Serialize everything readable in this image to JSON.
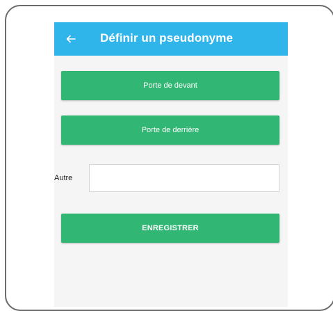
{
  "app_bar": {
    "title": "Définir un pseudonyme",
    "back_icon": "arrow-left-icon",
    "color": "#2fb5ea"
  },
  "buttons": {
    "front_door_label": "Porte de devant",
    "back_door_label": "Porte de derrière",
    "save_label": "ENREGISTRER",
    "color": "#31b673"
  },
  "other_field": {
    "label": "Autre",
    "value": "",
    "placeholder": ""
  }
}
